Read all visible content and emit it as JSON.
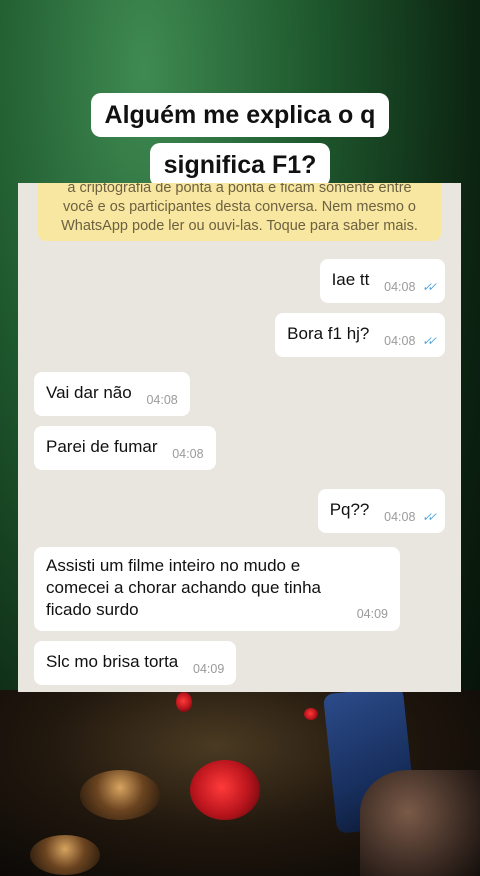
{
  "caption": {
    "line1": "Alguém me explica o q",
    "line2": "significa F1?"
  },
  "notice": {
    "line1": "a criptografia de ponta a ponta e ficam somente entre",
    "line2": "você e os participantes desta conversa. Nem mesmo o",
    "line3": "WhatsApp pode ler ou ouvi-las. Toque para saber mais."
  },
  "messages": [
    {
      "text": "Iae tt",
      "time": "04:08",
      "ticks": "✓✓"
    },
    {
      "text": "Bora f1 hj?",
      "time": "04:08",
      "ticks": "✓✓"
    },
    {
      "text": "Vai dar não",
      "time": "04:08"
    },
    {
      "text": "Parei de fumar",
      "time": "04:08"
    },
    {
      "text": "Pq??",
      "time": "04:08",
      "ticks": "✓✓"
    },
    {
      "text_l1": "Assisti um filme inteiro no mudo e",
      "text_l2": "comecei a chorar achando que tinha",
      "text_l3": "ficado surdo",
      "time": "04:09"
    },
    {
      "text": "Slc mo brisa torta",
      "time": "04:09"
    }
  ],
  "colors": {
    "bubble_out": "#ffffff",
    "bubble_in": "#ffffff",
    "chat_bg": "#e9e5df",
    "notice_bg": "#f8e7a0",
    "read_ticks": "#4fa3de"
  }
}
